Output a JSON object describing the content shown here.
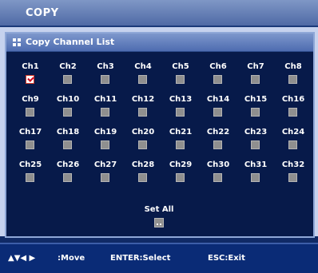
{
  "window": {
    "title": "COPY"
  },
  "panel": {
    "title": "Copy Channel List",
    "icon": "grid-icon"
  },
  "channels": [
    {
      "label": "Ch1",
      "checked": true
    },
    {
      "label": "Ch2",
      "checked": false
    },
    {
      "label": "Ch3",
      "checked": false
    },
    {
      "label": "Ch4",
      "checked": false
    },
    {
      "label": "Ch5",
      "checked": false
    },
    {
      "label": "Ch6",
      "checked": false
    },
    {
      "label": "Ch7",
      "checked": false
    },
    {
      "label": "Ch8",
      "checked": false
    },
    {
      "label": "Ch9",
      "checked": false
    },
    {
      "label": "Ch10",
      "checked": false
    },
    {
      "label": "Ch11",
      "checked": false
    },
    {
      "label": "Ch12",
      "checked": false
    },
    {
      "label": "Ch13",
      "checked": false
    },
    {
      "label": "Ch14",
      "checked": false
    },
    {
      "label": "Ch15",
      "checked": false
    },
    {
      "label": "Ch16",
      "checked": false
    },
    {
      "label": "Ch17",
      "checked": false
    },
    {
      "label": "Ch18",
      "checked": false
    },
    {
      "label": "Ch19",
      "checked": false
    },
    {
      "label": "Ch20",
      "checked": false
    },
    {
      "label": "Ch21",
      "checked": false
    },
    {
      "label": "Ch22",
      "checked": false
    },
    {
      "label": "Ch23",
      "checked": false
    },
    {
      "label": "Ch24",
      "checked": false
    },
    {
      "label": "Ch25",
      "checked": false
    },
    {
      "label": "Ch26",
      "checked": false
    },
    {
      "label": "Ch27",
      "checked": false
    },
    {
      "label": "Ch28",
      "checked": false
    },
    {
      "label": "Ch29",
      "checked": false
    },
    {
      "label": "Ch30",
      "checked": false
    },
    {
      "label": "Ch31",
      "checked": false
    },
    {
      "label": "Ch32",
      "checked": false
    }
  ],
  "set_all": {
    "label": "Set All",
    "checked": false
  },
  "help": {
    "move_keys": "▲▼◀ ▶",
    "move_text": ":Move",
    "select_text": "ENTER:Select",
    "exit_text": "ESC:Exit"
  },
  "colors": {
    "panel_bg": "#071a4a",
    "header_bg": "#5a77b8",
    "checkbox_gray": "#8f8f8f",
    "check_red": "#d4001a"
  }
}
